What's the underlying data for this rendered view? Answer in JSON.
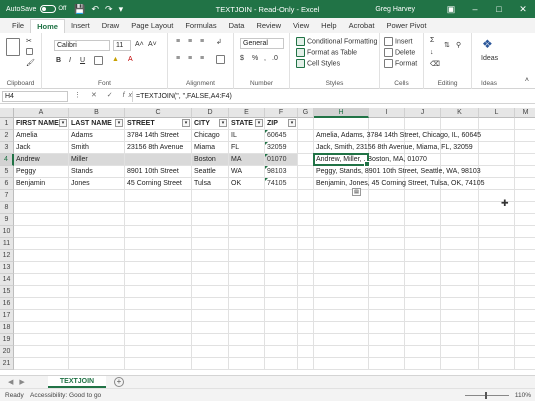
{
  "titlebar": {
    "autosave_label": "AutoSave",
    "autosave_state": "Off",
    "title": "TEXTJOIN - Read-Only - Excel",
    "user": "Greg Harvey",
    "qat_icons": [
      "save-icon",
      "undo-icon",
      "redo-icon"
    ]
  },
  "ribbon_tabs": [
    "File",
    "Home",
    "Insert",
    "Draw",
    "Page Layout",
    "Formulas",
    "Data",
    "Review",
    "View",
    "Help",
    "Acrobat",
    "Power Pivot"
  ],
  "ribbon": {
    "clipboard": {
      "label": "Clipboard"
    },
    "font": {
      "label": "Font",
      "font_name": "Calibri",
      "font_size": "11"
    },
    "alignment": {
      "label": "Alignment"
    },
    "number": {
      "label": "Number",
      "format": "General"
    },
    "styles": {
      "label": "Styles",
      "conditional": "Conditional Formatting",
      "table": "Format as Table",
      "cellstyles": "Cell Styles"
    },
    "cells": {
      "label": "Cells",
      "insert": "Insert",
      "delete": "Delete",
      "format": "Format"
    },
    "editing": {
      "label": "Editing"
    },
    "ideas": {
      "label": "Ideas",
      "button": "Ideas"
    }
  },
  "formula_bar": {
    "name_box": "H4",
    "formula": "=TEXTJOIN(\", \",FALSE,A4:F4)"
  },
  "columns": [
    "A",
    "B",
    "C",
    "D",
    "E",
    "F",
    "G",
    "H",
    "I",
    "J",
    "K",
    "L",
    "M"
  ],
  "rows": [
    "1",
    "2",
    "3",
    "4",
    "5",
    "6",
    "7",
    "8",
    "9",
    "10",
    "11",
    "12",
    "13",
    "14",
    "15",
    "16",
    "17",
    "18",
    "19",
    "20",
    "21"
  ],
  "table": {
    "headers": [
      "FIRST NAME",
      "LAST NAME",
      "STREET",
      "CITY",
      "STATE",
      "ZIP"
    ],
    "rows": [
      [
        "Amelia",
        "Adams",
        "3784 14th Street",
        "Chicago",
        "IL",
        "60645"
      ],
      [
        "Jack",
        "Smith",
        "23156 8th Avenue",
        "Miama",
        "FL",
        "32059"
      ],
      [
        "Andrew",
        "Miller",
        "",
        "Boston",
        "MA",
        "01070"
      ],
      [
        "Peggy",
        "Stands",
        "8901 10th Street",
        "Seattle",
        "WA",
        "98103"
      ],
      [
        "Benjamin",
        "Jones",
        "45 Corning Street",
        "Tulsa",
        "OK",
        "74105"
      ]
    ]
  },
  "results": [
    "Amelia, Adams, 3784 14th Street, Chicago, IL, 60645",
    "Jack, Smith, 23156 8th Avenue, Miama, FL, 32059",
    "Andrew, Miller, , Boston, MA, 01070",
    "Peggy, Stands, 8901 10th Street, Seattle, WA, 98103",
    "Benjamin, Jones, 45 Corning Street, Tulsa, OK, 74105"
  ],
  "sheet_tab": "TEXTJOIN",
  "status": {
    "ready": "Ready",
    "accessibility": "Accessibility: Good to go",
    "zoom": "110%"
  },
  "colors": {
    "accent": "#217346",
    "band": "#d9d9d9"
  }
}
